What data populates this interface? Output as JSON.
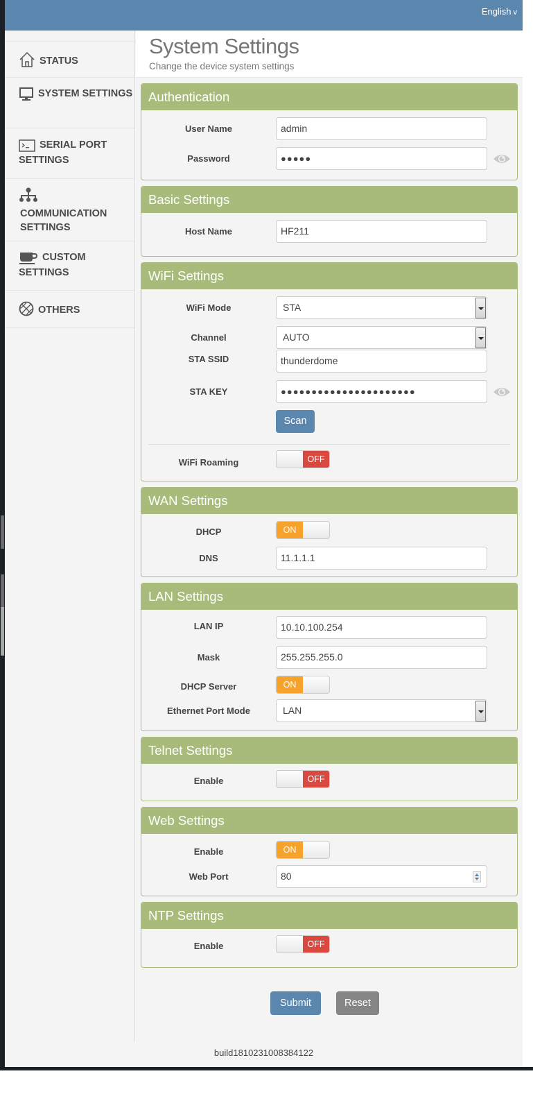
{
  "header": {
    "language": "English",
    "language_chevron": "v"
  },
  "sidebar": {
    "items": [
      {
        "label": "STATUS",
        "icon": "home-icon"
      },
      {
        "label": "SYSTEM SETTINGS",
        "icon": "monitor-icon"
      },
      {
        "label": "SERIAL PORT SETTINGS",
        "icon": "terminal-icon"
      },
      {
        "label": "COMMUNICATION SETTINGS",
        "icon": "network-icon"
      },
      {
        "label": "CUSTOM SETTINGS",
        "icon": "coffee-cup-icon"
      },
      {
        "label": "OTHERS",
        "icon": "basketball-icon"
      }
    ]
  },
  "page": {
    "title": "System Settings",
    "subtitle": "Change the device system settings"
  },
  "authentication": {
    "title": "Authentication",
    "user_name_label": "User Name",
    "user_name_value": "admin",
    "password_label": "Password",
    "password_value": "●●●●●"
  },
  "basic": {
    "title": "Basic Settings",
    "host_name_label": "Host Name",
    "host_name_value": "HF211"
  },
  "wifi": {
    "title": "WiFi Settings",
    "mode_label": "WiFi Mode",
    "mode_value": "STA",
    "channel_label": "Channel",
    "channel_value": "AUTO",
    "ssid_label": "STA SSID",
    "ssid_value": "thunderdome",
    "key_label": "STA KEY",
    "key_value": "●●●●●●●●●●●●●●●●●●●●●●",
    "scan_label": "Scan",
    "roaming_label": "WiFi Roaming",
    "roaming_state": "OFF"
  },
  "wan": {
    "title": "WAN Settings",
    "dhcp_label": "DHCP",
    "dhcp_state": "ON",
    "dns_label": "DNS",
    "dns_value": "11.1.1.1"
  },
  "lan": {
    "title": "LAN Settings",
    "ip_label": "LAN IP",
    "ip_value": "10.10.100.254",
    "mask_label": "Mask",
    "mask_value": "255.255.255.0",
    "dhcp_server_label": "DHCP Server",
    "dhcp_server_state": "ON",
    "eth_mode_label": "Ethernet Port Mode",
    "eth_mode_value": "LAN"
  },
  "telnet": {
    "title": "Telnet Settings",
    "enable_label": "Enable",
    "enable_state": "OFF"
  },
  "web": {
    "title": "Web Settings",
    "enable_label": "Enable",
    "enable_state": "ON",
    "port_label": "Web Port",
    "port_value": "80"
  },
  "ntp": {
    "title": "NTP Settings",
    "enable_label": "Enable",
    "enable_state": "OFF"
  },
  "actions": {
    "submit_label": "Submit",
    "reset_label": "Reset"
  },
  "footer": {
    "build": "build1810231008384122"
  },
  "colors": {
    "topbar": "#5b86ae",
    "card_header": "#a8bb7a",
    "toggle_on": "#f7a22b",
    "toggle_off": "#d9493f",
    "primary_button": "#5b86ae",
    "reset_button": "#858585"
  }
}
